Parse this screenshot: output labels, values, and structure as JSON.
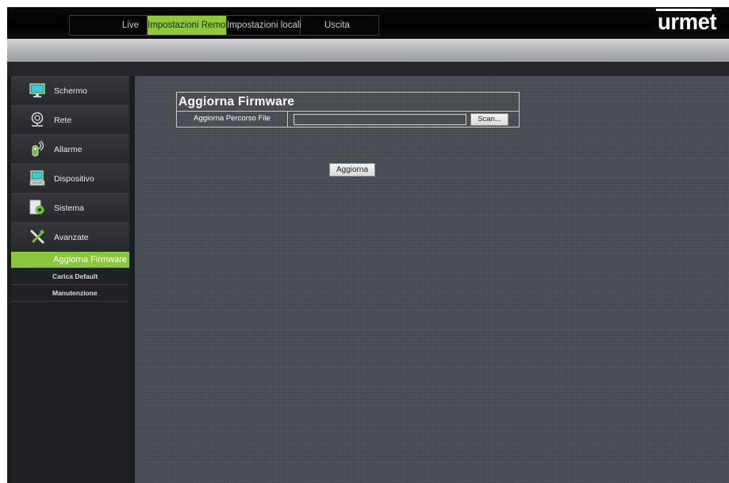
{
  "nav": {
    "tabs": [
      "Live",
      "Impostazioni Remote",
      "Impostazioni locali",
      "Uscita"
    ],
    "active_tab": "Impostazioni Remote"
  },
  "brand": {
    "logo": "urmet"
  },
  "colors": {
    "accent": "#8cc63f",
    "content_bg": "#4a4f56",
    "sidebar_bg": "#1e2124"
  },
  "sidebar": {
    "items": [
      {
        "label": "Schermo",
        "icon": "monitor-icon"
      },
      {
        "label": "Rete",
        "icon": "network-icon"
      },
      {
        "label": "Allarme",
        "icon": "alarm-icon"
      },
      {
        "label": "Dispositivo",
        "icon": "device-icon"
      },
      {
        "label": "Sistema",
        "icon": "system-icon"
      },
      {
        "label": "Avanzate",
        "icon": "tools-icon"
      }
    ],
    "subitems": [
      {
        "label": "Aggiorna Firmware",
        "active": true
      },
      {
        "label": "Carica Default",
        "active": false
      },
      {
        "label": "Manutenzione",
        "active": false
      }
    ]
  },
  "main": {
    "title": "Aggiorna Firmware",
    "path_label": "Aggiorna Percorso File",
    "path_value": "",
    "scan_label": "Scan...",
    "update_label": "Aggiorna"
  }
}
